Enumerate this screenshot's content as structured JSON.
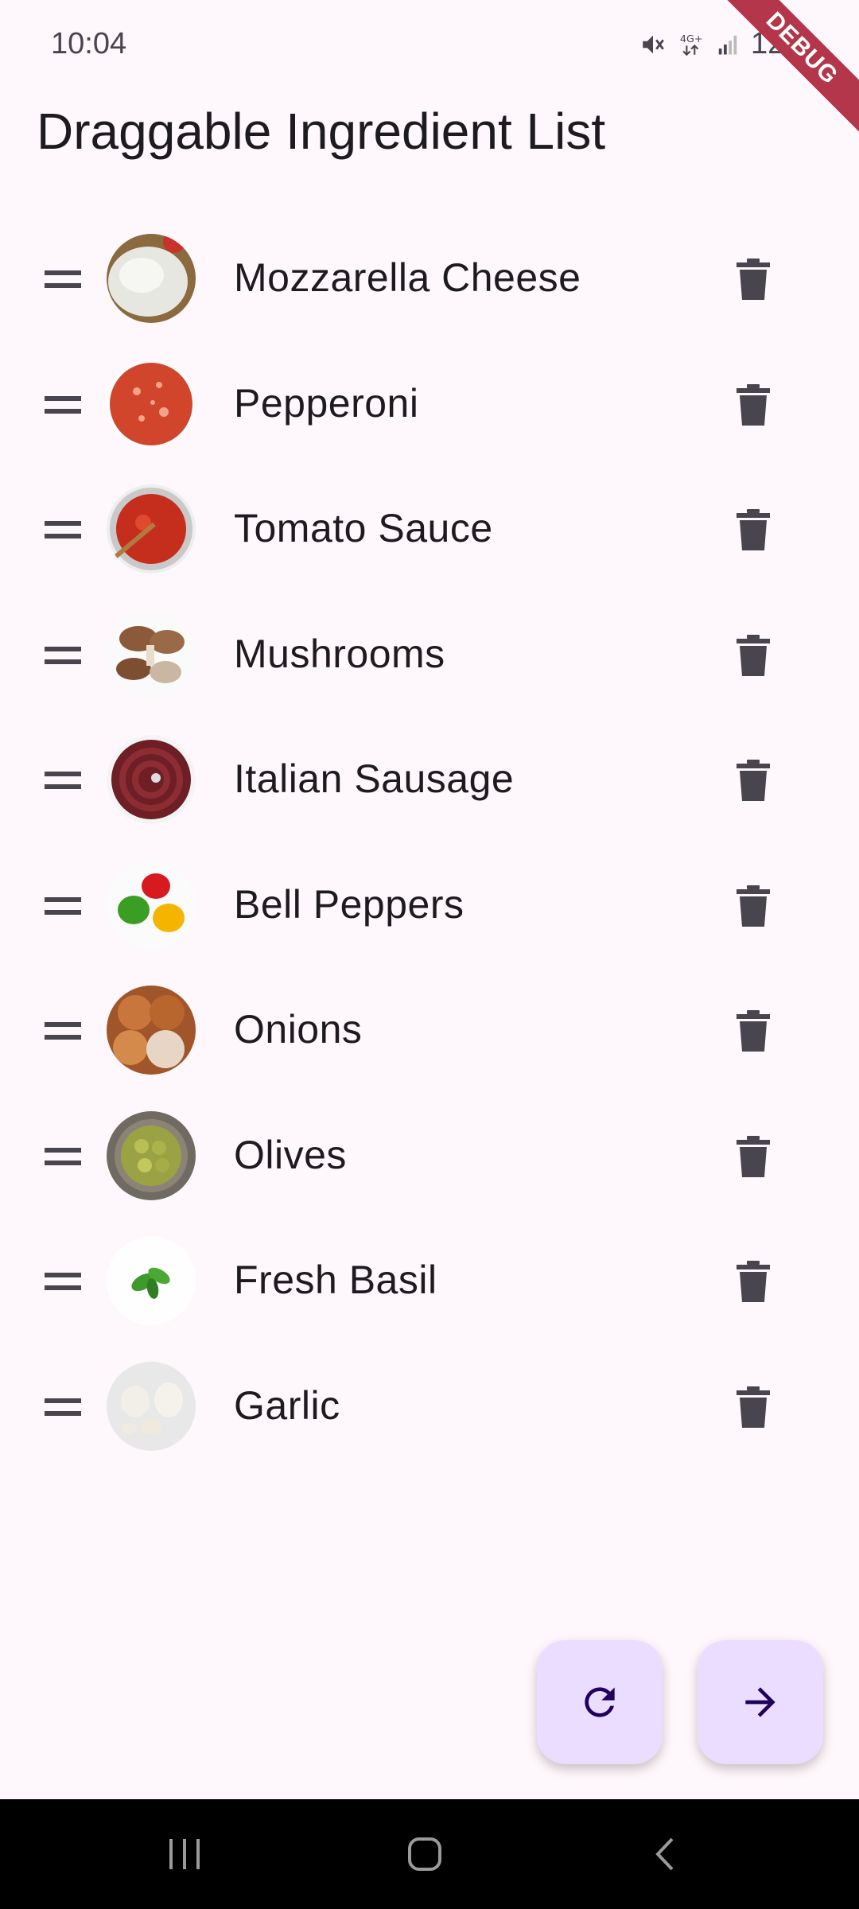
{
  "status_bar": {
    "time": "10:04",
    "battery": "12%"
  },
  "debug_banner": "DEBUG",
  "page": {
    "title": "Draggable Ingredient List"
  },
  "ingredients": [
    {
      "name": "Mozzarella Cheese",
      "image": "mozzarella-image"
    },
    {
      "name": "Pepperoni",
      "image": "pepperoni-image"
    },
    {
      "name": "Tomato Sauce",
      "image": "tomato-sauce-image"
    },
    {
      "name": "Mushrooms",
      "image": "mushrooms-image"
    },
    {
      "name": "Italian Sausage",
      "image": "sausage-image"
    },
    {
      "name": "Bell Peppers",
      "image": "bell-peppers-image"
    },
    {
      "name": "Onions",
      "image": "onions-image"
    },
    {
      "name": "Olives",
      "image": "olives-image"
    },
    {
      "name": "Fresh Basil",
      "image": "basil-image"
    },
    {
      "name": "Garlic",
      "image": "garlic-image"
    }
  ],
  "icons": {
    "drag": "drag-handle-icon",
    "delete": "trash-icon",
    "refresh": "refresh-icon",
    "next": "arrow-forward-icon"
  },
  "colors": {
    "background": "#fef7fc",
    "fab": "#eaddff",
    "fab_icon": "#21005d",
    "icon": "#49454f",
    "debug": "#b3364a"
  }
}
